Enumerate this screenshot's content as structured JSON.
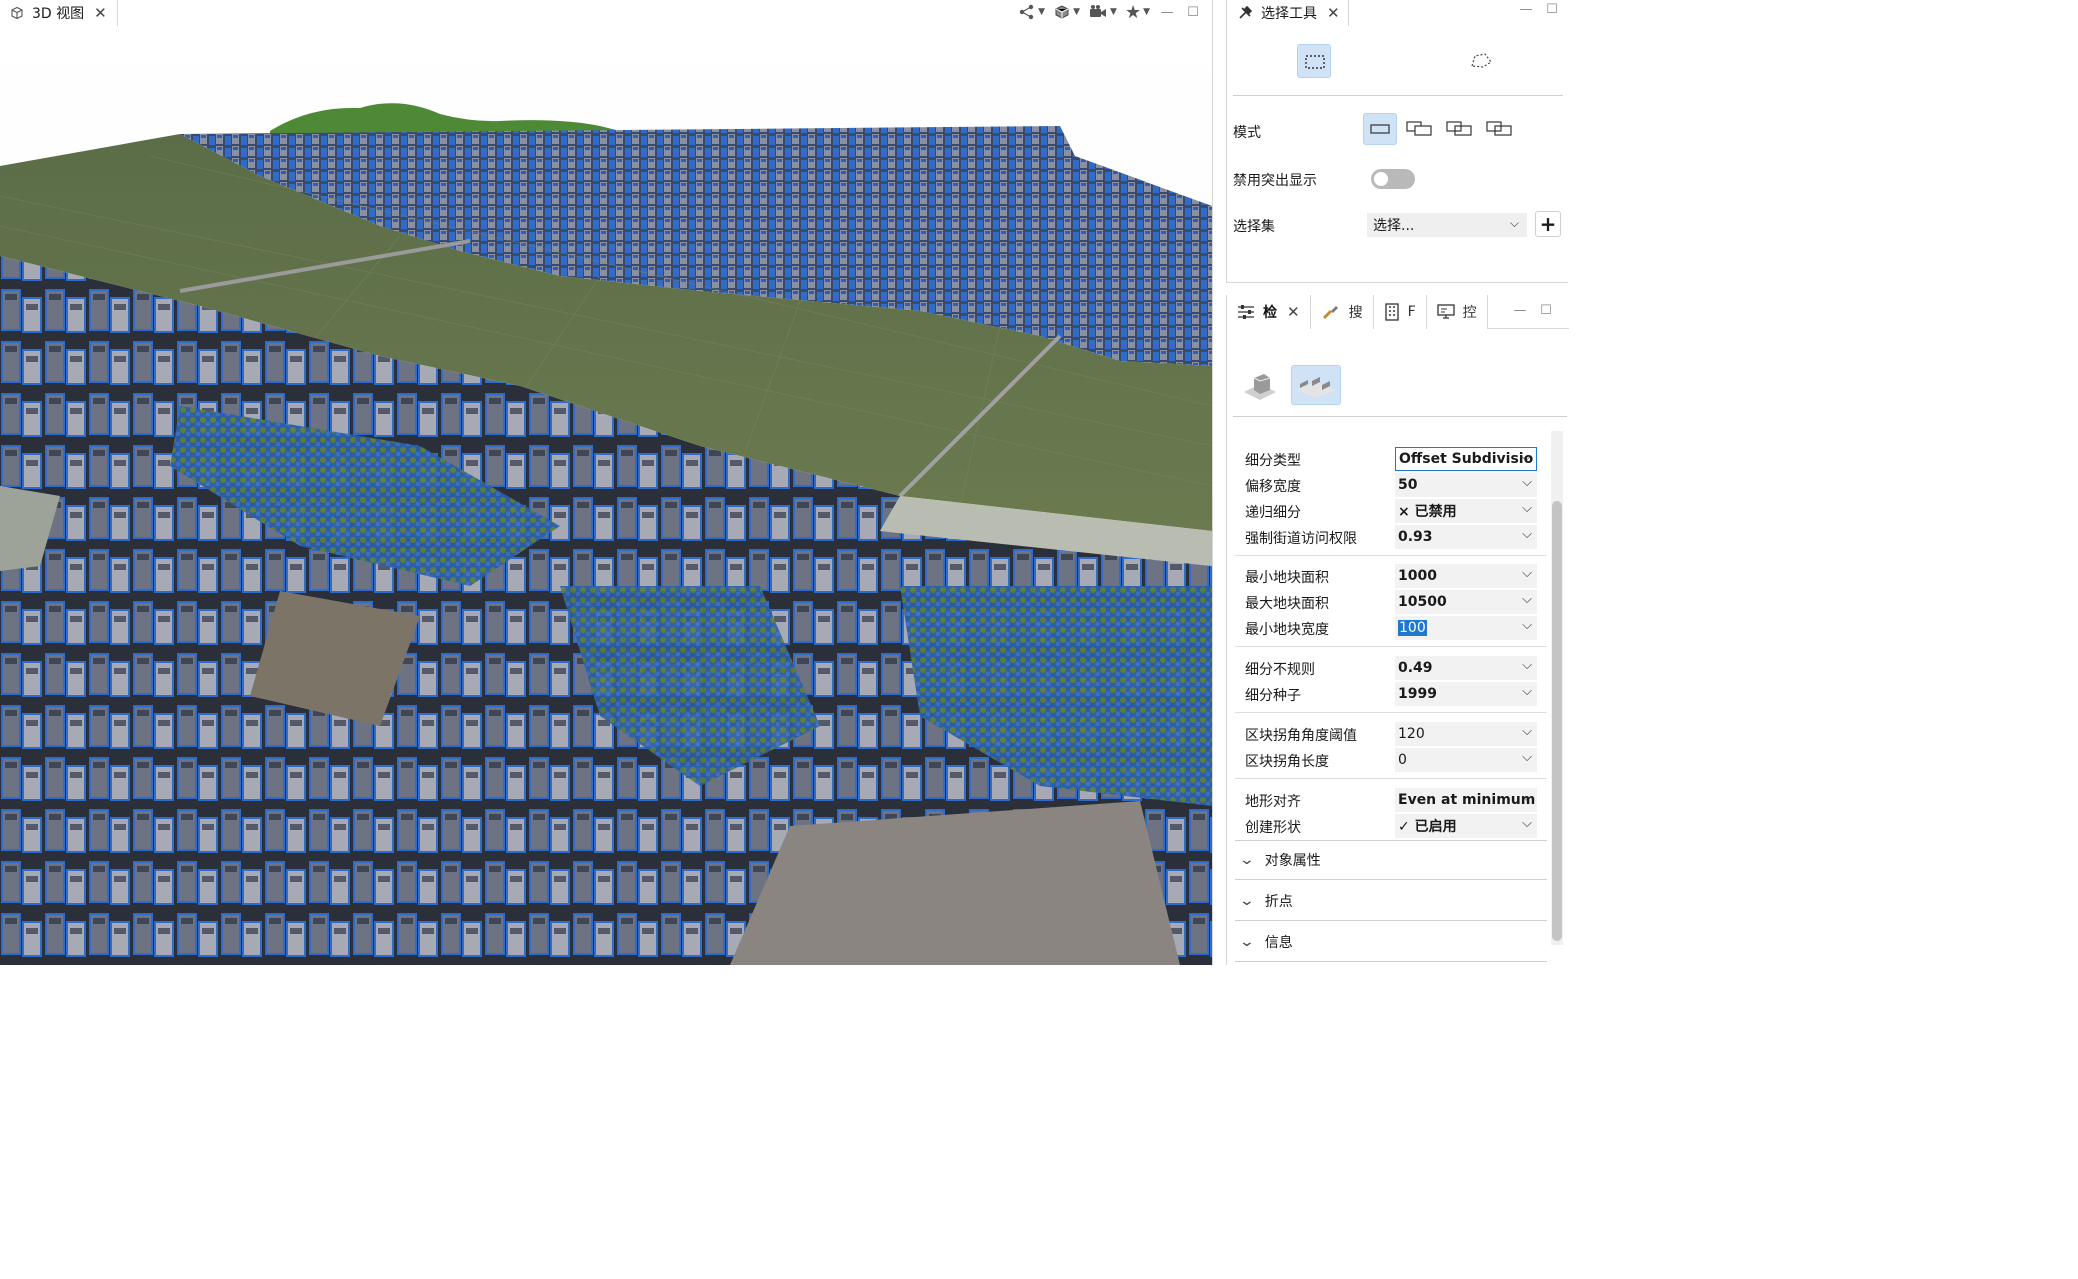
{
  "view3d": {
    "tab_label": "3D 视图",
    "close_glyph": "✕",
    "toolbar": [
      {
        "icon": "network-icon",
        "glyph": "⛓"
      },
      {
        "icon": "cube-icon",
        "glyph": "▣"
      },
      {
        "icon": "camera-icon",
        "glyph": "◙"
      },
      {
        "icon": "star-icon",
        "glyph": "★"
      }
    ],
    "win_minimize": "—",
    "win_maximize": "☐"
  },
  "select_tool": {
    "tab_label": "选择工具",
    "close_glyph": "✕",
    "win_minimize": "—",
    "win_maximize": "☐",
    "mode_label": "模式",
    "highlight_label": "禁用突出显示",
    "selection_set_label": "选择集",
    "selection_set_value": "选择...",
    "selection_set_caret": "⌵",
    "plus_glyph": "+"
  },
  "inspector": {
    "tabs": [
      {
        "icon": "sliders-icon",
        "label": "检",
        "active": true
      },
      {
        "icon": "search-brush-icon",
        "label": "搜"
      },
      {
        "icon": "building-grid-icon",
        "label": "F"
      },
      {
        "icon": "monitor-icon",
        "label": "控"
      }
    ],
    "close_glyph": "✕",
    "win_minimize": "—",
    "win_maximize": "☐",
    "dropdown_glyph": "⌵",
    "attributes": [
      {
        "label": "细分类型",
        "value": "Offset Subdivisio",
        "style": "boxed"
      },
      {
        "label": "偏移宽度",
        "value": "50"
      },
      {
        "label": "递归细分",
        "value": "× 已禁用"
      },
      {
        "label": "强制街道访问权限",
        "value": "0.93"
      },
      {
        "label": "最小地块面积",
        "value": "1000"
      },
      {
        "label": "最大地块面积",
        "value": "10500"
      },
      {
        "label": "最小地块宽度",
        "value": "100",
        "style": "selected"
      },
      {
        "label": "细分不规则",
        "value": "0.49"
      },
      {
        "label": "细分种子",
        "value": "1999"
      },
      {
        "label": "区块拐角角度阈值",
        "value": "120",
        "style": "plain"
      },
      {
        "label": "区块拐角长度",
        "value": "0",
        "style": "plain"
      },
      {
        "label": "地形对齐",
        "value": "Even at minimum"
      },
      {
        "label": "创建形状",
        "value": "✓ 已启用"
      }
    ],
    "sections": [
      {
        "label": "对象属性",
        "chevron": "⌄"
      },
      {
        "label": "折点",
        "chevron": "⌄"
      },
      {
        "label": "信息",
        "chevron": "⌄"
      }
    ]
  },
  "colors": {
    "accent": "#1e78d2",
    "selected_bg": "#cfe2f6",
    "grass": "#4f6a3c",
    "building_blue": "#2f6bc8"
  }
}
